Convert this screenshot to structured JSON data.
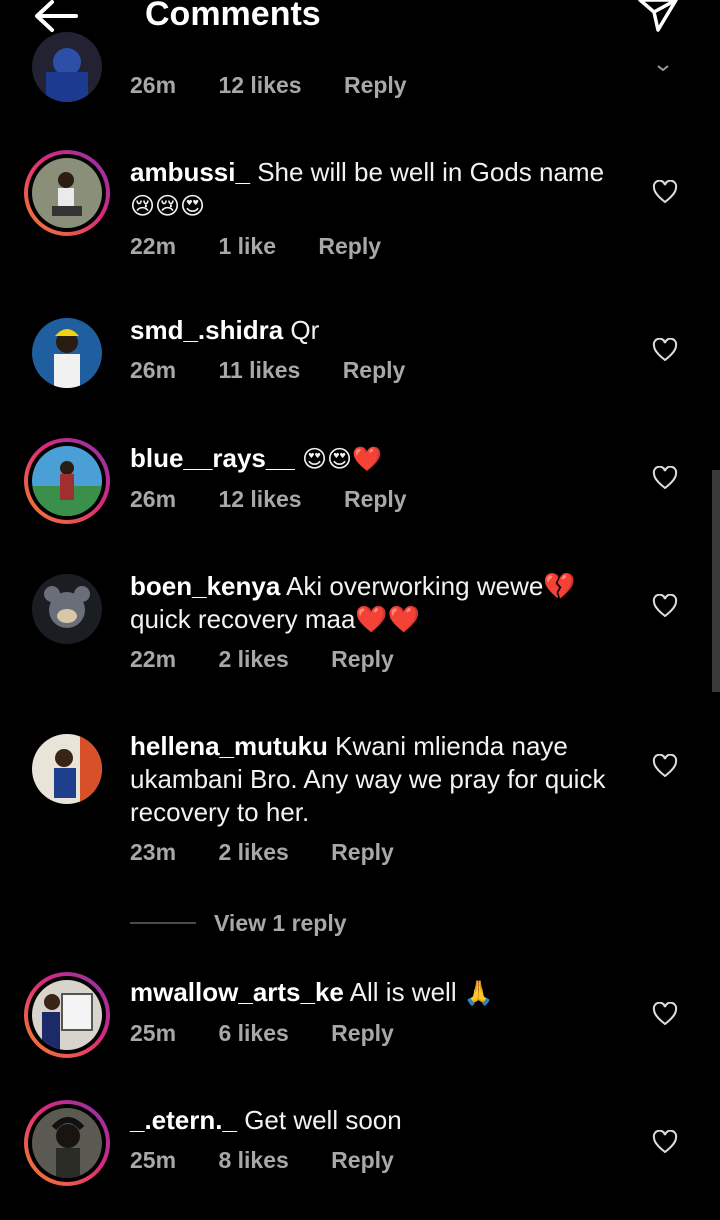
{
  "header": {
    "title": "Comments"
  },
  "comments": [
    {
      "time": "26m",
      "likes": "12 likes",
      "reply": "Reply"
    },
    {
      "user": "ambussi_",
      "text": "She will be well in Gods name",
      "emoji": "😢😢😍",
      "time": "22m",
      "likes": "1 like",
      "reply": "Reply"
    },
    {
      "user": "smd_.shidra",
      "text": "Qr",
      "time": "26m",
      "likes": "11 likes",
      "reply": "Reply"
    },
    {
      "user": "blue__rays__",
      "text": "",
      "emoji": "😍😍❤️",
      "time": "26m",
      "likes": "12 likes",
      "reply": "Reply"
    },
    {
      "user": "boen_kenya",
      "text": "Aki overworking wewe💔 quick recovery maa❤️❤️",
      "time": "22m",
      "likes": "2 likes",
      "reply": "Reply"
    },
    {
      "user": "hellena_mutuku",
      "text": "Kwani mlienda naye ukambani Bro. Any way we pray for quick recovery to her.",
      "time": "23m",
      "likes": "2 likes",
      "reply": "Reply"
    },
    {
      "user": "mwallow_arts_ke",
      "text": "All is well",
      "emoji": "🙏",
      "time": "25m",
      "likes": "6 likes",
      "reply": "Reply"
    },
    {
      "user": "_.etern._",
      "text": "Get well soon",
      "time": "25m",
      "likes": "8 likes",
      "reply": "Reply"
    }
  ],
  "view_replies": "View 1 reply",
  "colors": {
    "background": "#000000",
    "meta_text": "#a8a8a8",
    "story_ring": "#dd2a7b"
  },
  "icons": [
    "back-arrow-icon",
    "send-icon",
    "heart-icon",
    "chevron-down-icon"
  ]
}
